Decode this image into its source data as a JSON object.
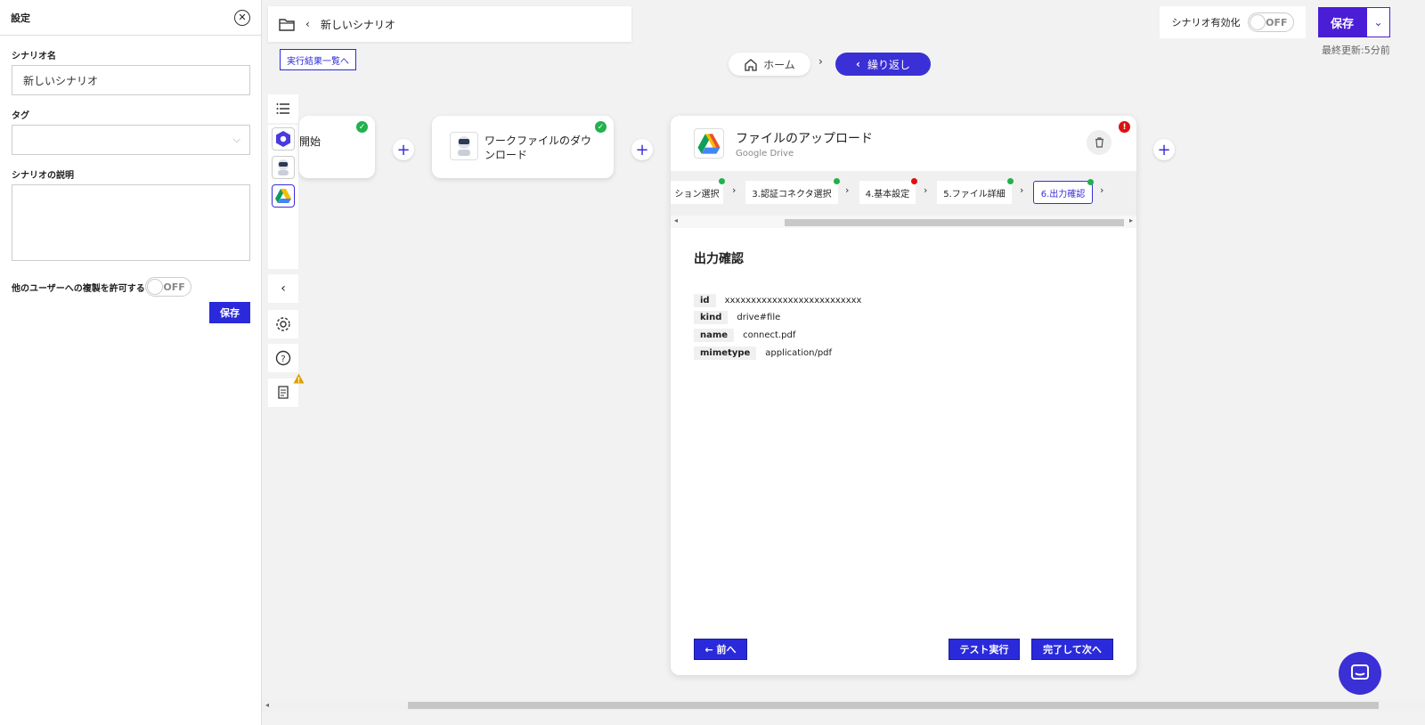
{
  "settings": {
    "title": "設定",
    "scenario_name_label": "シナリオ名",
    "scenario_name_value": "新しいシナリオ",
    "tag_label": "タグ",
    "description_label": "シナリオの説明",
    "copy_permission_label": "他のユーザーへの複製を許可する",
    "copy_toggle_state": "OFF",
    "save_label": "保存"
  },
  "header": {
    "scenario_title": "新しいシナリオ",
    "exec_results_link": "実行結果一覧へ",
    "breadcrumb_home": "ホーム",
    "breadcrumb_loop": "繰り返し",
    "activate_label": "シナリオ有効化",
    "activate_state": "OFF",
    "save_label": "保存",
    "last_update": "最終更新:5分前"
  },
  "nodes": {
    "start_label": "開始",
    "download_label_line1": "ワークファイルのダウ",
    "download_label_line2": "ンロード"
  },
  "card": {
    "title": "ファイルのアップロード",
    "subtitle": "Google Drive",
    "tabs": [
      {
        "label": "ション選択",
        "status": "ok"
      },
      {
        "label": "3.認証コネクタ選択",
        "status": "ok"
      },
      {
        "label": "4.基本設定",
        "status": "error"
      },
      {
        "label": "5.ファイル詳細",
        "status": "ok"
      },
      {
        "label": "6.出力確認",
        "status": "ok"
      }
    ],
    "output_title": "出力確認",
    "outputs": [
      {
        "key": "id",
        "value": "xxxxxxxxxxxxxxxxxxxxxxxxxx"
      },
      {
        "key": "kind",
        "value": "drive#file"
      },
      {
        "key": "name",
        "value": "connect.pdf"
      },
      {
        "key": "mimetype",
        "value": "application/pdf"
      }
    ],
    "prev_label": "← 前へ",
    "test_label": "テスト実行",
    "next_label": "完了して次へ"
  },
  "colors": {
    "accent": "#3b2fd6",
    "button_blue": "#2a2adb",
    "ok": "#22b14c",
    "error": "#dd1111"
  }
}
